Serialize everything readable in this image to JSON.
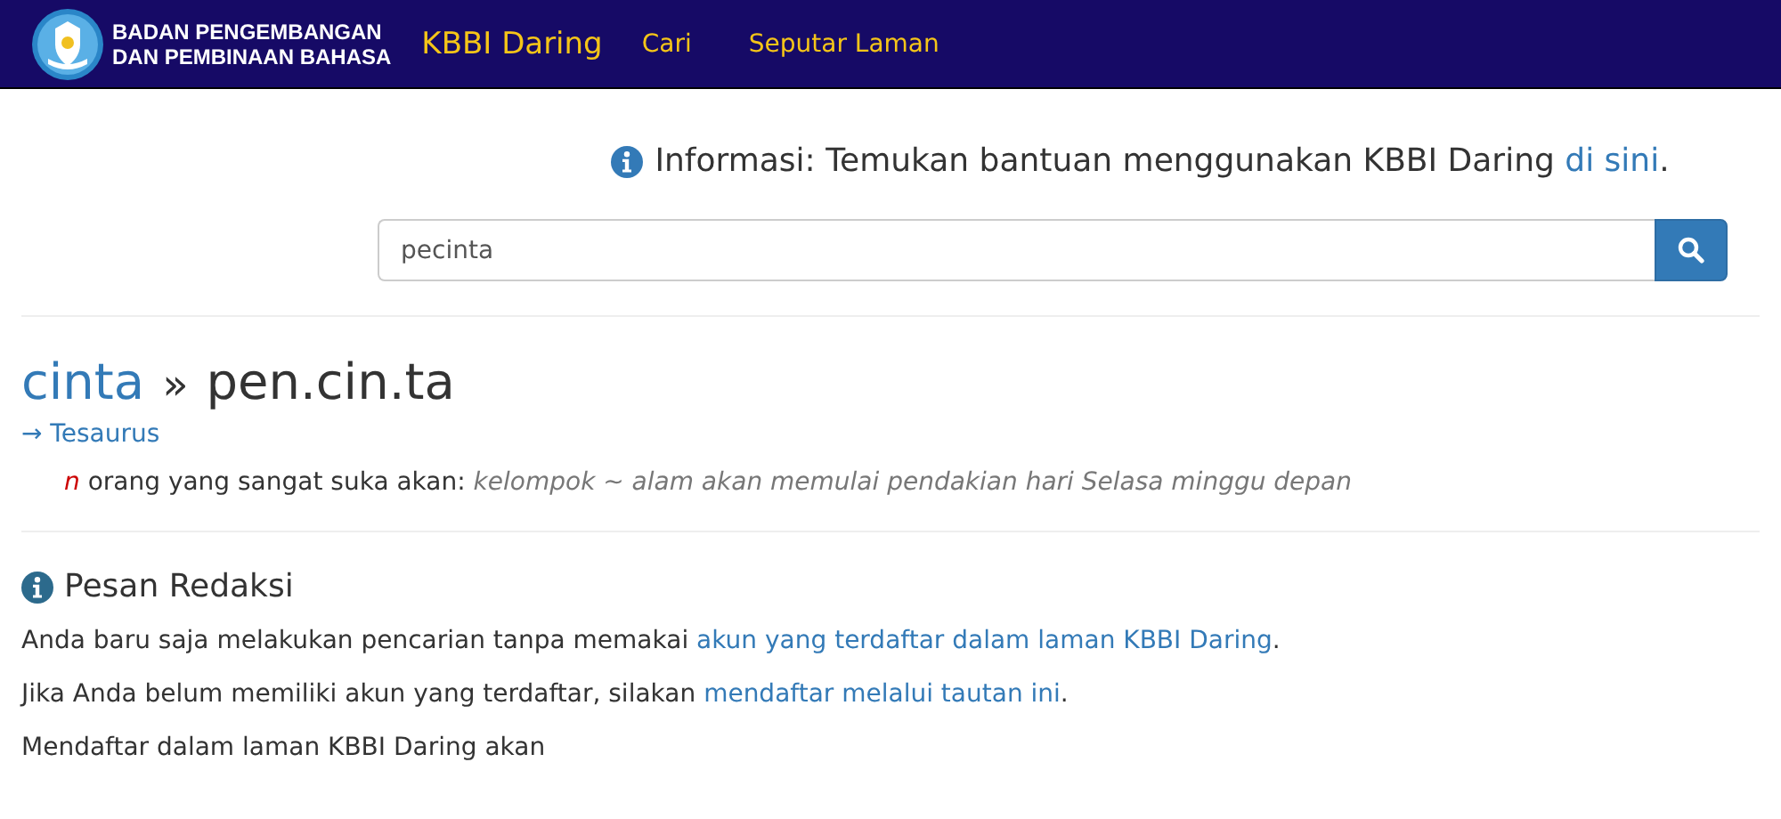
{
  "header": {
    "org_lines": [
      "BADAN PENGEMBANGAN",
      "DAN PEMBINAAN BAHASA"
    ],
    "brand": "KBBI Daring",
    "nav": [
      "Cari",
      "Seputar Laman"
    ]
  },
  "info": {
    "label": "Informasi: Temukan bantuan menggunakan KBBI Daring ",
    "link": "di sini",
    "after": "."
  },
  "search": {
    "value": "pecinta"
  },
  "entry": {
    "root": "cinta",
    "separator": "»",
    "headword": "pen.cin.ta",
    "thesaurus": "→ Tesaurus",
    "pos": "n",
    "definition": "orang yang sangat suka akan:",
    "example": "kelompok ~ alam akan memulai pendakian hari Selasa minggu depan"
  },
  "notice": {
    "title": "Pesan Redaksi",
    "paragraphs": [
      {
        "before": "Anda baru saja melakukan pencarian tanpa memakai ",
        "link": "akun yang terdaftar dalam laman KBBI Daring",
        "after": "."
      },
      {
        "before": "Jika Anda belum memiliki akun yang terdaftar, silakan ",
        "link": "mendaftar melalui tautan ini",
        "after": "."
      },
      {
        "before": "Mendaftar dalam laman KBBI Daring akan"
      }
    ]
  }
}
